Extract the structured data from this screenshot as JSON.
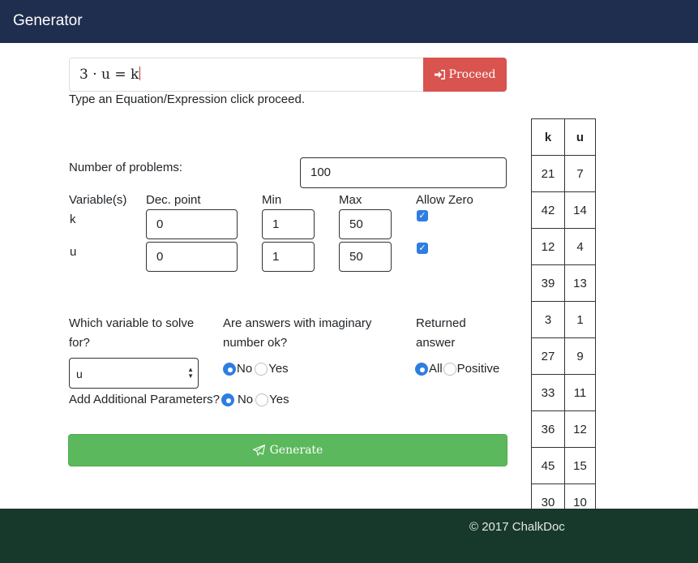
{
  "app": {
    "title": "Generator"
  },
  "equation": {
    "value": "3 · u = k"
  },
  "proceed_label": "Proceed",
  "hint": "Type an Equation/Expression click proceed.",
  "num_problems": {
    "label": "Number of problems:",
    "value": "100"
  },
  "columns": {
    "variables": "Variable(s)",
    "dec_point": "Dec. point",
    "min": "Min",
    "max": "Max",
    "allow_zero": "Allow Zero"
  },
  "variables": [
    {
      "name": "k",
      "dec": "0",
      "min": "1",
      "max": "50",
      "allow_zero": true
    },
    {
      "name": "u",
      "dec": "0",
      "min": "1",
      "max": "50",
      "allow_zero": true
    }
  ],
  "solve_for": {
    "label_line1": "Which variable to solve",
    "label_line2": "for?",
    "selected": "u"
  },
  "imaginary": {
    "label_line1": "Are answers with imaginary",
    "label_line2": "number ok?",
    "options": [
      "No",
      "Yes"
    ],
    "selected": "No"
  },
  "returned": {
    "label_line1": "Returned",
    "label_line2": "answer",
    "options": [
      "All",
      "Positive"
    ],
    "selected": "All"
  },
  "additional": {
    "label": "Add Additional Parameters?",
    "options": [
      "No",
      "Yes"
    ],
    "selected": "No"
  },
  "generate_label": "Generate",
  "results": {
    "headers": [
      "k",
      "u"
    ],
    "rows": [
      [
        "21",
        "7"
      ],
      [
        "42",
        "14"
      ],
      [
        "12",
        "4"
      ],
      [
        "39",
        "13"
      ],
      [
        "3",
        "1"
      ],
      [
        "27",
        "9"
      ],
      [
        "33",
        "11"
      ],
      [
        "36",
        "12"
      ],
      [
        "45",
        "15"
      ],
      [
        "30",
        "10"
      ]
    ]
  },
  "footer": {
    "copyright": "© 2017 ChalkDoc"
  },
  "colors": {
    "navbar": "#1f2d4f",
    "proceed": "#d9534f",
    "generate": "#5cb85c",
    "footer": "#17392c",
    "accent": "#2f7de1"
  }
}
